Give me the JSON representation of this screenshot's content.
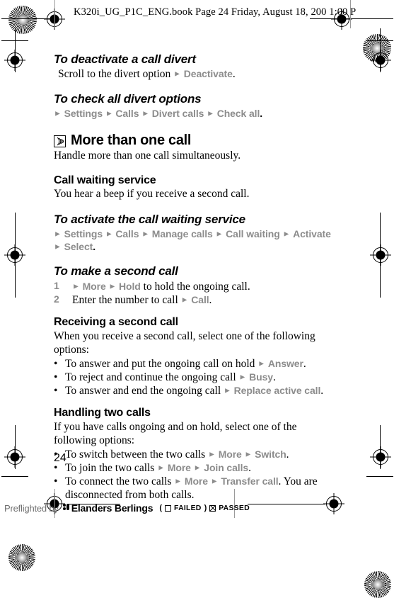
{
  "header": {
    "running_head": "K320i_UG_P1C_ENG.book  Page 24  Friday, August 18, 200   1:00 P"
  },
  "folio": {
    "page_number": "24"
  },
  "colors": {
    "ui_path_gray": "#8c8c8c",
    "body_black": "#000000",
    "footer_gray": "#6f6f6f"
  },
  "content": {
    "section_1": {
      "heading": "To deactivate a call divert",
      "line_prefix": "Scroll to the divert option ",
      "ui_1": "Deactivate",
      "line_suffix": "."
    },
    "section_2": {
      "heading": "To check all divert options",
      "path": [
        "Settings",
        "Calls",
        "Divert calls",
        "Check all"
      ],
      "terminator": "."
    },
    "chapter": {
      "icon": "calling-waves-icon",
      "title": "More than one call",
      "intro": "Handle more than one call simultaneously."
    },
    "section_3": {
      "heading": "Call waiting service",
      "body": "You hear a beep if you receive a second call."
    },
    "section_4": {
      "heading": "To activate the call waiting service",
      "path_line_1": [
        "Settings",
        "Calls",
        "Manage calls",
        "Call waiting",
        "Activate"
      ],
      "path_line_2": [
        "Select"
      ],
      "terminator": "."
    },
    "section_5": {
      "heading": "To make a second call",
      "steps": [
        {
          "num": "1",
          "lead_ui": [
            "More",
            "Hold"
          ],
          "text": " to hold the ongoing call."
        },
        {
          "num": "2",
          "text_before": "Enter the number to call ",
          "ui": "Call",
          "text_after": "."
        }
      ]
    },
    "section_6": {
      "heading": "Receiving a second call",
      "body": "When you receive a second call, select one of the following options:",
      "bullets": [
        {
          "text_before": "To answer and put the ongoing call on hold ",
          "ui": [
            "Answer"
          ],
          "text_after": "."
        },
        {
          "text_before": "To reject and continue the ongoing call ",
          "ui": [
            "Busy"
          ],
          "text_after": "."
        },
        {
          "text_before": "To answer and end the ongoing call ",
          "ui": [
            "Replace active call"
          ],
          "text_after": "."
        }
      ]
    },
    "section_7": {
      "heading": "Handling two calls",
      "body": "If you have calls ongoing and on hold, select one of the following options:",
      "bullets": [
        {
          "text_before": "To switch between the two calls ",
          "ui": [
            "More",
            "Switch"
          ],
          "text_after": "."
        },
        {
          "text_before": "To join the two calls ",
          "ui": [
            "More",
            "Join calls"
          ],
          "text_after": "."
        },
        {
          "text_before": "To connect the two calls ",
          "ui": [
            "More",
            "Transfer call"
          ],
          "text_after": ". You are disconnected from both calls."
        }
      ]
    }
  },
  "footer": {
    "preflight_label": "Preflighted by",
    "brand": "Elanders Berlings",
    "paren_open": "(",
    "failed_label": "FAILED",
    "paren_close": ")",
    "passed_label": "PASSED"
  }
}
